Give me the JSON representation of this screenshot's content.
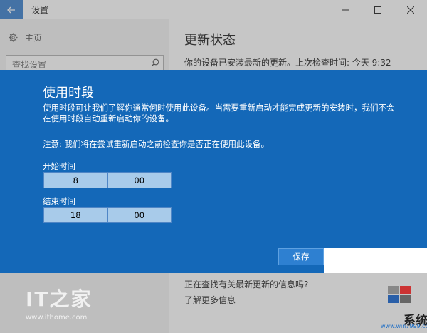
{
  "window": {
    "title": "设置"
  },
  "sidebar": {
    "home_label": "主页",
    "search_placeholder": "查找设置"
  },
  "main": {
    "title": "更新状态",
    "status": "你的设备已安装最新的更新。上次检查时间: 今天 9:32",
    "question": "正在查找有关最新更新的信息吗?",
    "learn_more": "了解更多信息"
  },
  "dialog": {
    "title": "使用时段",
    "description": "使用时段可让我们了解你通常何时使用此设备。当需要重新启动才能完成更新的安装时，我们不会在使用时段自动重新启动你的设备。",
    "note": "注意: 我们将在尝试重新启动之前检查你是否正在使用此设备。",
    "start_label": "开始时间",
    "start_hour": "8",
    "start_minute": "00",
    "end_label": "结束时间",
    "end_hour": "18",
    "end_minute": "00",
    "save_label": "保存"
  },
  "watermarks": {
    "left_logo": "IT之家",
    "left_url": "www.ithome.com",
    "right_text": "系统粉",
    "right_url": "www.win7999.com"
  },
  "colors": {
    "accent": "#1468b8",
    "back_button": "#1f6fc6",
    "time_field": "#a8cbea"
  }
}
